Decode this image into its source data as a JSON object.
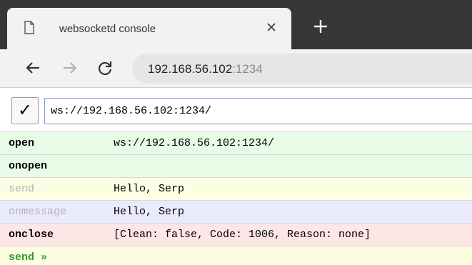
{
  "browser": {
    "tab": {
      "title": "websocketd console"
    },
    "address": {
      "host": "192.168.56.102",
      "port": ":1234"
    }
  },
  "console": {
    "send_button_glyph": "✓",
    "input_value": "ws://192.168.56.102:1234/",
    "log": [
      {
        "type": "open",
        "label": "open",
        "message": "ws://192.168.56.102:1234/"
      },
      {
        "type": "onopen",
        "label": "onopen",
        "message": ""
      },
      {
        "type": "send",
        "label": "send",
        "message": "Hello, Serp"
      },
      {
        "type": "onmessage",
        "label": "onmessage",
        "message": "Hello, Serp"
      },
      {
        "type": "onclose",
        "label": "onclose",
        "message": "[Clean: false, Code: 1006, Reason: none]"
      }
    ],
    "prompt_label": "send »"
  },
  "icons": {
    "tab_page": "page-icon",
    "tab_close": "close-icon",
    "new_tab": "plus-icon",
    "back": "arrow-left-icon",
    "forward": "arrow-right-icon",
    "reload": "reload-icon"
  },
  "colors": {
    "tabstrip": "#333333",
    "toolbar": "#f2f2f2",
    "row_green": "#e7fbe7",
    "row_yellow": "#fdfde3",
    "row_blue": "#eaeafd",
    "row_red": "#fde6e6",
    "prompt_green": "#2e9b2e"
  }
}
